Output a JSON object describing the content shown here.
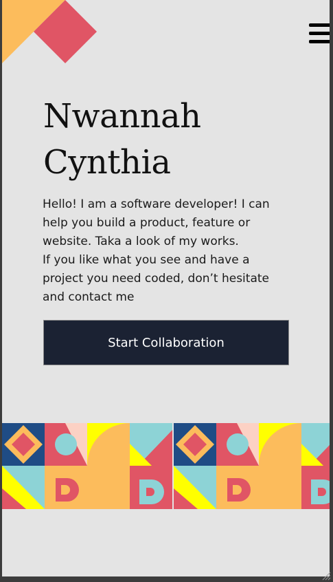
{
  "hero": {
    "name_line1": "Nwannah",
    "name_line2": "Cynthia",
    "bio_line1": "Hello! I am a software developer! I can",
    "bio_line2": "help you build a product, feature or",
    "bio_line3": "website. Taka a look of my works.",
    "bio_line4": "If you like what you see and have a",
    "bio_line5": "project you need coded, don’t hesitate",
    "bio_line6": "and contact me",
    "cta_label": "Start Collaboration"
  },
  "icons": {
    "menu": "hamburger-menu-icon",
    "corner": "geometric-corner-decoration",
    "banner": "geometric-pattern-banner"
  },
  "colors": {
    "background": "#e4e4e4",
    "cta_bg": "#1b2233",
    "coral": "#e05565",
    "orange": "#fcbc5c",
    "yellow": "#ffff00",
    "teal": "#8dd3d6",
    "navy": "#1f4c85",
    "peach": "#fcd1c4"
  }
}
